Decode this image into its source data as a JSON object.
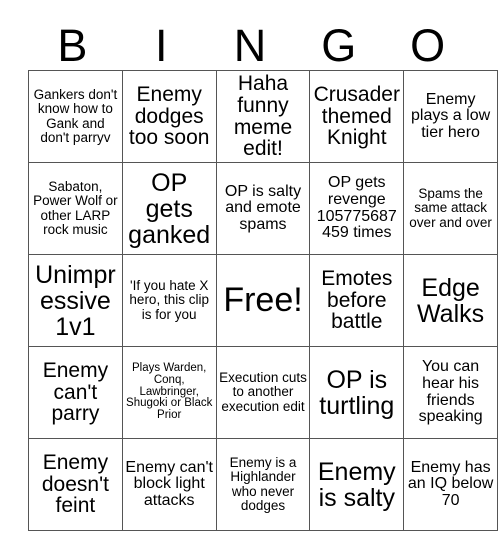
{
  "card": {
    "title_letters": [
      "B",
      "I",
      "N",
      "G",
      "O"
    ],
    "rows": [
      [
        "Gankers don't know how to Gank and don't parryv",
        "Enemy dodges too soon",
        "Haha funny meme edit!",
        "Crusader themed Knight",
        "Enemy plays a low tier hero"
      ],
      [
        "Sabaton, Power Wolf or other LARP rock music",
        "OP gets ganked",
        "OP is salty and emote spams",
        "OP gets revenge 105775687459 times",
        "Spams the same attack over and over"
      ],
      [
        "Unimpressive 1v1",
        "'If you hate X hero, this clip is for you",
        "Free!",
        "Emotes before battle",
        "Edge Walks"
      ],
      [
        "Enemy can't parry",
        "Plays Warden, Conq, Lawbringer, Shugoki or Black Prior",
        "Execution cuts to another execution edit",
        "OP is turtling",
        "You can hear his friends speaking"
      ],
      [
        "Enemy doesn't feint",
        "Enemy can't block light attacks",
        "Enemy is a Highlander who never dodges",
        "Enemy is salty",
        "Enemy has an IQ below 70"
      ]
    ],
    "free_space": "Free!",
    "colors": {
      "background": "#ffffff",
      "text": "#000000",
      "grid_line": "#555555"
    }
  }
}
